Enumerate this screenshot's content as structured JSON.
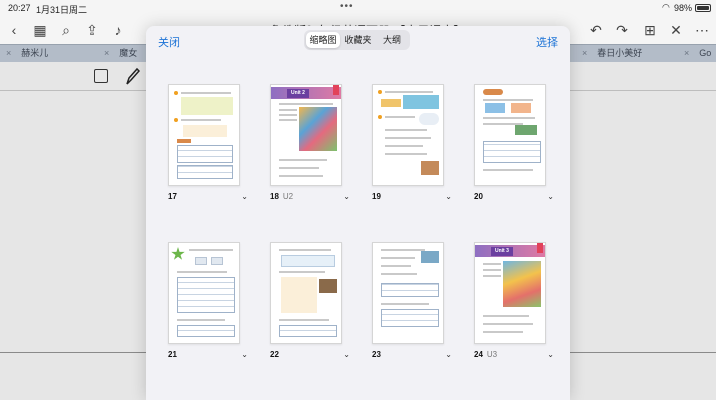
{
  "statusbar": {
    "time": "20:27",
    "date": "1月31日周二",
    "battery": "98%"
  },
  "toolbar": {
    "doc_title": "鲁教版？年级英语下册 【电子课本】"
  },
  "tabs": [
    {
      "label": "赫米儿"
    },
    {
      "label": "魔女"
    },
    {
      "label": "春日小美好"
    },
    {
      "label": "Go"
    }
  ],
  "modal": {
    "close_label": "关闭",
    "select_label": "选择",
    "segments": [
      {
        "label": "缩略图",
        "active": true
      },
      {
        "label": "收藏夹",
        "active": false
      },
      {
        "label": "大纲",
        "active": false
      }
    ],
    "pages": [
      {
        "number": "17",
        "unit": ""
      },
      {
        "number": "18",
        "unit": "U2"
      },
      {
        "number": "19",
        "unit": ""
      },
      {
        "number": "20",
        "unit": ""
      },
      {
        "number": "21",
        "unit": ""
      },
      {
        "number": "22",
        "unit": ""
      },
      {
        "number": "23",
        "unit": ""
      },
      {
        "number": "24",
        "unit": "U3"
      }
    ],
    "unit_badges": [
      "Unit 2",
      "Unit 3"
    ]
  },
  "colors": {
    "accent": "#1d73d6",
    "tabbar": "#b3bcc8",
    "unit_badge": "#6b3fa0"
  }
}
